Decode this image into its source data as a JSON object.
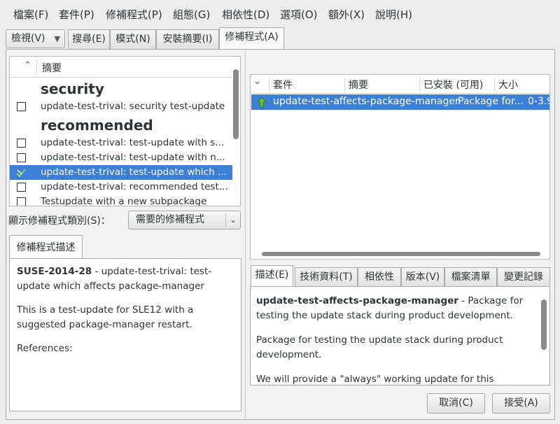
{
  "menubar": {
    "items": [
      "檔案(F)",
      "套件(P)",
      "修補程式(P)",
      "組態(G)",
      "相依性(D)",
      "選項(O)",
      "額外(X)",
      "說明(H)"
    ]
  },
  "toolbar": {
    "view_combo": "檢視(V)",
    "tabs": [
      "搜尋(E)",
      "模式(N)",
      "安裝摘要(I)",
      "修補程式(A)"
    ]
  },
  "patch_list": {
    "header": "摘要",
    "groups": [
      {
        "title": "security",
        "items": [
          {
            "label": "update-test-trival: security test-update",
            "state": "unchecked"
          }
        ]
      },
      {
        "title": "recommended",
        "items": [
          {
            "label": "update-test-trival: test-update with s...",
            "state": "unchecked"
          },
          {
            "label": "update-test-trival: test-update with n...",
            "state": "unchecked"
          },
          {
            "label": "update-test-trival: test-update which ...",
            "state": "install"
          },
          {
            "label": "update-test-trival: recommended test...",
            "state": "unchecked"
          },
          {
            "label": "Testupdate with a new subpackage",
            "state": "unchecked"
          }
        ]
      }
    ]
  },
  "category": {
    "label": "顯示修補程式類別(S)：",
    "selected": "需要的修補程式"
  },
  "patch_description": {
    "tab": "修補程式描述",
    "id": "SUSE-2014-28",
    "summary": " - update-test-trival: test-update which affects package-manager",
    "body": "This is a test-update for SLE12 with a suggested package-manager restart.",
    "references": "References:"
  },
  "package_table": {
    "columns": [
      "套件",
      "摘要",
      "已安裝 (可用)",
      "大小"
    ],
    "row": {
      "name": "update-test-affects-package-manager",
      "summary": "Package for...",
      "installed": "0-3.9"
    }
  },
  "detail_tabs": [
    "描述(E)",
    "技術資料(T)",
    "相依性",
    "版本(V)",
    "檔案清單",
    "變更記錄"
  ],
  "detail": {
    "pkg_name": "update-test-affects-package-manager",
    "pkg_short": " - Package for testing the update stack during product development.",
    "para1": "Package for testing the update stack during product development.",
    "para2": "We will provide a \"always\" working update for this package"
  },
  "buttons": {
    "cancel": "取消(C)",
    "accept": "接受(A)"
  },
  "colors": {
    "selection": "#3c7fd6",
    "background": "#ededed"
  }
}
